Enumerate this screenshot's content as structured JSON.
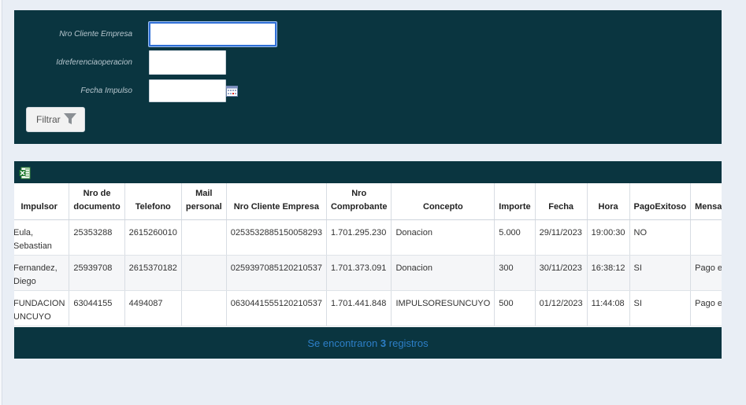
{
  "filters": {
    "nro_cliente_label": "Nro Cliente Empresa",
    "nro_cliente_value": "",
    "idref_label": "Idreferenciaoperacion",
    "idref_value": "",
    "fecha_label": "Fecha Impulso",
    "fecha_value": "",
    "filter_button": "Filtrar",
    "filter_icon": "funnel-icon",
    "calendar_icon": "calendar-icon"
  },
  "grid": {
    "export_icon": "excel-export-icon",
    "columns": [
      [
        "Impulsor"
      ],
      [
        "Nro de",
        "documento"
      ],
      [
        "Telefono"
      ],
      [
        "Mail",
        "personal"
      ],
      [
        "Nro Cliente Empresa"
      ],
      [
        "Nro",
        "Comprobante"
      ],
      [
        "Concepto"
      ],
      [
        "Importe"
      ],
      [
        "Fecha"
      ],
      [
        "Hora"
      ],
      [
        "PagoExitoso"
      ],
      [
        "MensajeRe"
      ]
    ],
    "rows": [
      {
        "impulsor": [
          "Eula,",
          "Sebastian"
        ],
        "documento": "25353288",
        "telefono": "2615260010",
        "mail": "",
        "nro_cliente": "0253532885150058293",
        "comprobante": "1.701.295.230",
        "concepto": "Donacion",
        "importe": "5.000",
        "fecha": "29/11/2023",
        "hora": "19:00:30",
        "pago": "NO",
        "mensaje": ""
      },
      {
        "impulsor": [
          "Fernandez,",
          "Diego"
        ],
        "documento": "25939708",
        "telefono": "2615370182",
        "mail": "",
        "nro_cliente": "0259397085120210537",
        "comprobante": "1.701.373.091",
        "concepto": "Donacion",
        "importe": "300",
        "fecha": "30/11/2023",
        "hora": "16:38:12",
        "pago": "SI",
        "mensaje": "Pago exito"
      },
      {
        "impulsor": [
          "FUNDACION",
          "UNCUYO"
        ],
        "documento": "63044155",
        "telefono": "4494087",
        "mail": "",
        "nro_cliente": "0630441555120210537",
        "comprobante": "1.701.441.848",
        "concepto": "IMPULSORESUNCUYO",
        "importe": "500",
        "fecha": "01/12/2023",
        "hora": "11:44:08",
        "pago": "SI",
        "mensaje": "Pago exito"
      }
    ],
    "footer_prefix": "Se encontraron",
    "footer_count": "3",
    "footer_suffix": "registros"
  }
}
